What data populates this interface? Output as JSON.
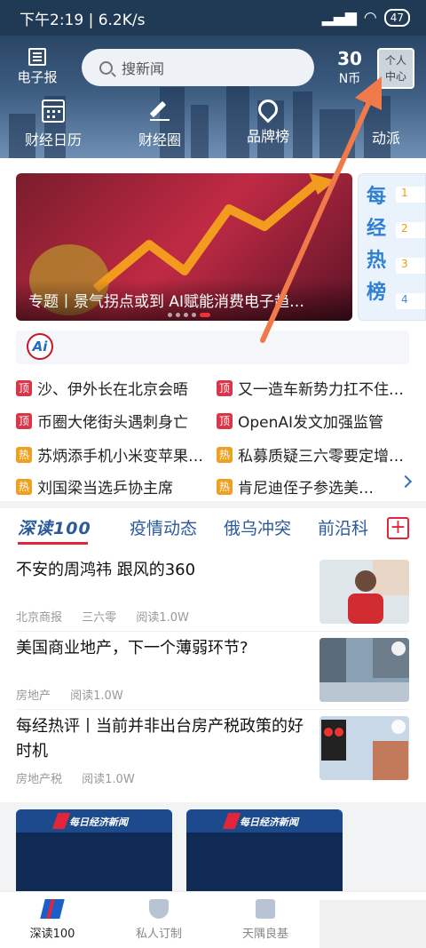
{
  "status_bar": {
    "time_info": "下午2:19 | 6.2K/s",
    "battery": "47"
  },
  "header": {
    "epaper_label": "电子报",
    "search_placeholder": "搜新闻",
    "coins_value": "30",
    "coins_unit": "N币",
    "profile_label_line1": "个人",
    "profile_label_line2": "中心"
  },
  "quick_nav": [
    {
      "label": "财经日历",
      "icon": "calendar-icon"
    },
    {
      "label": "财经圈",
      "icon": "pen-icon"
    },
    {
      "label": "品牌榜",
      "icon": "badge-icon"
    },
    {
      "label": "动派",
      "icon": ""
    }
  ],
  "banner": {
    "caption": "专题丨景气拐点或到 AI赋能消费电子趋…",
    "side_card_vertical_text": [
      "每",
      "经",
      "热",
      "榜"
    ],
    "side_ranks": [
      "1",
      "2",
      "3",
      "4"
    ]
  },
  "headlines": [
    {
      "tag": "顶",
      "type": "top",
      "text": "沙、伊外长在北京会晤"
    },
    {
      "tag": "顶",
      "type": "top",
      "text": "又一造车新势力扛不住…"
    },
    {
      "tag": "顶",
      "type": "top",
      "text": "币圈大佬街头遇刺身亡"
    },
    {
      "tag": "顶",
      "type": "top",
      "text": "OpenAI发文加强监管"
    },
    {
      "tag": "热",
      "type": "hot",
      "text": "苏炳添手机小米变苹果…"
    },
    {
      "tag": "热",
      "type": "hot",
      "text": "私募质疑三六零要定增…"
    },
    {
      "tag": "热",
      "type": "hot",
      "text": "刘国梁当选乒协主席"
    },
    {
      "tag": "热",
      "type": "hot",
      "text": "肯尼迪侄子参选美…"
    }
  ],
  "tabs": {
    "items": [
      "深读100",
      "疫情动态",
      "俄乌冲突",
      "前沿科"
    ],
    "add_label": "+"
  },
  "news": [
    {
      "title": "不安的周鸿祎 跟风的360",
      "source": "北京商报",
      "extra": "三六零",
      "reads": "阅读1.0W"
    },
    {
      "title": "美国商业地产，下一个薄弱环节?",
      "source": "房地产",
      "extra": "",
      "reads": "阅读1.0W"
    },
    {
      "title": "每经热评丨当前并非出台房产税政策的好时机",
      "source": "房地产税",
      "extra": "",
      "reads": "阅读1.0W"
    }
  ],
  "video_cards": [
    {
      "brand": "每日经济新闻"
    },
    {
      "brand": "每日经济新闻"
    }
  ],
  "bottom_nav": [
    {
      "label": "深读100",
      "active": true
    },
    {
      "label": "私人订制",
      "active": false
    },
    {
      "label": "天隅良基",
      "active": false
    }
  ],
  "colors": {
    "accent_red": "#e2263a",
    "brand_blue": "#2a5a9a",
    "header_bg": "#203a56"
  }
}
